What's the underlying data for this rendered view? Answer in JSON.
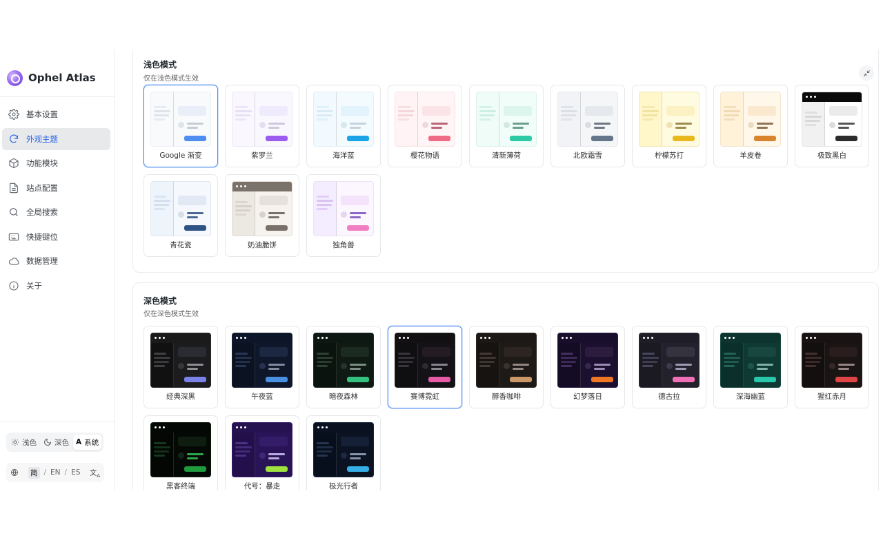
{
  "brand": {
    "name": "Ophel Atlas"
  },
  "nav": [
    {
      "label": "基本设置",
      "icon": "gear-icon"
    },
    {
      "label": "外观主题",
      "icon": "palette-icon",
      "active": true
    },
    {
      "label": "功能模块",
      "icon": "cube-icon"
    },
    {
      "label": "站点配置",
      "icon": "document-icon"
    },
    {
      "label": "全局搜索",
      "icon": "search-icon"
    },
    {
      "label": "快捷键位",
      "icon": "keyboard-icon"
    },
    {
      "label": "数据管理",
      "icon": "cloud-icon"
    },
    {
      "label": "关于",
      "icon": "info-icon"
    }
  ],
  "mode_switch": {
    "light": "浅色",
    "dark": "深色",
    "system_prefix": "A",
    "system": "系统",
    "selected": "system"
  },
  "language": {
    "options": [
      "简",
      "EN",
      "ES"
    ],
    "selected": "简",
    "separator": "/"
  },
  "light_section": {
    "title": "浅色模式",
    "subtitle": "仅在浅色模式生效",
    "themes": [
      {
        "name": "Google 渐变",
        "selected": true,
        "bg": "#f8fafc",
        "side": "#f8fafc",
        "bar": "#dfe3ea",
        "bar_hi": "#e6ebf5",
        "block": "#e9eef8",
        "dot": "#dfe3ea",
        "line": "#c7ccd4",
        "accent": "#4f8ef0",
        "top": null,
        "border": "#eceff3"
      },
      {
        "name": "紫罗兰",
        "bg": "#faf8ff",
        "side": "#faf7ff",
        "bar": "#e6e0f5",
        "bar_hi": "#ece4fb",
        "block": "#efeafc",
        "dot": "#e3def0",
        "line": "#cfc8dd",
        "accent": "#9b5cf0",
        "top": null,
        "border": "#ece8f6"
      },
      {
        "name": "海洋蓝",
        "bg": "#f4fbff",
        "side": "#f2faff",
        "bar": "#d7ebf5",
        "bar_hi": "#dcf1fb",
        "block": "#e3f3fc",
        "dot": "#d8e6ee",
        "line": "#c2d3dd",
        "accent": "#1aa3e6",
        "top": null,
        "border": "#e2eef5"
      },
      {
        "name": "樱花物语",
        "bg": "#fff5f6",
        "side": "#fff3f5",
        "bar": "#f4d6db",
        "bar_hi": "#f8dde2",
        "block": "#fbe4e8",
        "dot": "#efd8dc",
        "line": "#b96675",
        "accent": "#ef6a84",
        "top": null,
        "border": "#f6e2e5"
      },
      {
        "name": "清新薄荷",
        "bg": "#f1fdf9",
        "side": "#effcf8",
        "bar": "#cdeee3",
        "bar_hi": "#d4f3e8",
        "block": "#dcf6ed",
        "dot": "#d1e9e1",
        "line": "#6a9f90",
        "accent": "#2ec9a5",
        "top": null,
        "border": "#dcf2ea"
      },
      {
        "name": "北欧霜雪",
        "bg": "#f4f6f8",
        "side": "#f1f3f6",
        "bar": "#dcdfe4",
        "bar_hi": "#e0e3e8",
        "block": "#e5e8ec",
        "dot": "#d9dce1",
        "line": "#6f7784",
        "accent": "#66768a",
        "top": null,
        "border": "#e6e9ed"
      },
      {
        "name": "柠檬苏打",
        "bg": "#fffbe0",
        "side": "#fff7c9",
        "bar": "#f1e2a0",
        "bar_hi": "#f5e8b0",
        "block": "#fcf1c4",
        "dot": "#efe3b2",
        "line": "#9e8a4d",
        "accent": "#e9b81c",
        "top": null,
        "border": "#f3e7b5"
      },
      {
        "name": "羊皮卷",
        "bg": "#fff8ea",
        "side": "#fff2d9",
        "bar": "#f0dab4",
        "bar_hi": "#f3dfbd",
        "block": "#fae9cf",
        "dot": "#eddcc3",
        "line": "#8f7352",
        "accent": "#d9832a",
        "top": null,
        "border": "#f2e5cf"
      },
      {
        "name": "极致黑白",
        "bg": "#ffffff",
        "side": "#f1f1f1",
        "bar": "#d8d8d8",
        "bar_hi": "#e0e0e0",
        "block": "#ebebeb",
        "dot": "#dcdcdc",
        "line": "#555555",
        "accent": "#2c2c2c",
        "top": "#0a0a0a",
        "border": "#e5e5e5"
      },
      {
        "name": "青花瓷",
        "bg": "#f5f8fd",
        "side": "#eef4fc",
        "bar": "#d3dfef",
        "bar_hi": "#dae4f2",
        "block": "#e2e9f4",
        "dot": "#d7dfea",
        "line": "#4b6a93",
        "accent": "#2f5384",
        "top": null,
        "border": "#e1e8f2"
      },
      {
        "name": "奶油脆饼",
        "bg": "#f6f3ef",
        "side": "#ece8e2",
        "bar": "#d6d0c8",
        "bar_hi": "#dcd6ce",
        "block": "#e6e1da",
        "dot": "#d8d2ca",
        "line": "#77706a",
        "accent": "#7a7069",
        "top": "#7b726b",
        "border": "#e3ddd6"
      },
      {
        "name": "独角兽",
        "bg": "#fcf6ff",
        "side": "#f4ecff",
        "bar": "#d9c3f2",
        "bar_hi": "#e3cdf8",
        "block": "#f4e3fb",
        "dot": "#e6d6ef",
        "line": "#8a68c9",
        "accent": "#f17ec2",
        "top": null,
        "border": "#efe1f7"
      }
    ]
  },
  "dark_section": {
    "title": "深色模式",
    "subtitle": "仅在深色模式生效",
    "themes": [
      {
        "name": "经典深黑",
        "bg": "#1c1c1e",
        "side": "#111112",
        "bar": "#3a3a3d",
        "bar_hi": "#414145",
        "block": "#2b2b33",
        "dot": "#38383c",
        "line": "#8e8e94",
        "accent": "#7b82e6",
        "top": "#1a1a1b",
        "border": "#2a2a2c"
      },
      {
        "name": "午夜蓝",
        "bg": "#0f172a",
        "side": "#0b1222",
        "bar": "#24304a",
        "bar_hi": "#2a3656",
        "block": "#1c2742",
        "dot": "#263250",
        "line": "#7f8aa3",
        "accent": "#4a90e2",
        "top": "#0d1528",
        "border": "#1b2438"
      },
      {
        "name": "暗夜森林",
        "bg": "#0f1a14",
        "side": "#0a130e",
        "bar": "#2a3a30",
        "bar_hi": "#2f4035",
        "block": "#1b2b21",
        "dot": "#26342b",
        "line": "#7c8f82",
        "accent": "#34c17e",
        "top": "#0e1812",
        "border": "#1c2a22"
      },
      {
        "name": "赛博霓虹",
        "selected": true,
        "bg": "#141216",
        "side": "#0f0e10",
        "bar": "#332f36",
        "bar_hi": "#3a343d",
        "block": "#231c22",
        "dot": "#2f2a31",
        "line": "#8a848d",
        "accent": "#e75aa8",
        "top": "#121013",
        "border": "#242126"
      },
      {
        "name": "醇香咖啡",
        "bg": "#1e1a18",
        "side": "#171311",
        "bar": "#3d3532",
        "bar_hi": "#443b37",
        "block": "#2d2522",
        "dot": "#3a322f",
        "line": "#938780",
        "accent": "#c99768",
        "top": "#1c1816",
        "border": "#2c2623"
      },
      {
        "name": "幻梦落日",
        "bg": "#1c1030",
        "side": "#140b24",
        "bar": "#3a2a55",
        "bar_hi": "#43305f",
        "block": "#2c1c3e",
        "dot": "#36264c",
        "line": "#9a8ab5",
        "accent": "#f07624",
        "top": "#190e2c",
        "border": "#2a1c40"
      },
      {
        "name": "德古拉",
        "bg": "#22212c",
        "side": "#1b1a23",
        "bar": "#3f3d52",
        "bar_hi": "#47455c",
        "block": "#35333f",
        "dot": "#3c3a4c",
        "line": "#9d9bb3",
        "accent": "#f06fb6",
        "top": "#1f1e28",
        "border": "#302e3c"
      },
      {
        "name": "深海幽蓝",
        "bg": "#0f3a34",
        "side": "#0b2f2a",
        "bar": "#1f5b51",
        "bar_hi": "#246357",
        "block": "#17473f",
        "dot": "#1d554b",
        "line": "#7eb0a6",
        "accent": "#29c7ac",
        "top": "#0d342f",
        "border": "#174740"
      },
      {
        "name": "猩红赤月",
        "bg": "#1a1414",
        "side": "#140f0f",
        "bar": "#3a2a2a",
        "bar_hi": "#443030",
        "block": "#2a1d1d",
        "dot": "#352828",
        "line": "#968484",
        "accent": "#e04444",
        "top": "#181212",
        "border": "#2a2020"
      },
      {
        "name": "黑客终端",
        "bg": "#050905",
        "side": "#030603",
        "bar": "#143018",
        "bar_hi": "#17381c",
        "block": "#0e1d10",
        "dot": "#132616",
        "line": "#2da84a",
        "accent": "#1f9a3c",
        "top": "#040804",
        "border": "#0f1c10"
      },
      {
        "name": "代号：暴走",
        "bg": "#2a1458",
        "side": "#230f4b",
        "bar": "#442b7a",
        "bar_hi": "#4c3187",
        "block": "#351c68",
        "dot": "#412874",
        "line": "#b9aee0",
        "accent": "#9ee23f",
        "top": "#261250",
        "border": "#381e6a"
      },
      {
        "name": "极光行者",
        "bg": "#0b1322",
        "side": "#080f1c",
        "bar": "#1f2d45",
        "bar_hi": "#25344f",
        "block": "#152036",
        "dot": "#1c2940",
        "line": "#8593ab",
        "accent": "#36aee8",
        "top": "#0a1120",
        "border": "#17223a"
      }
    ]
  }
}
